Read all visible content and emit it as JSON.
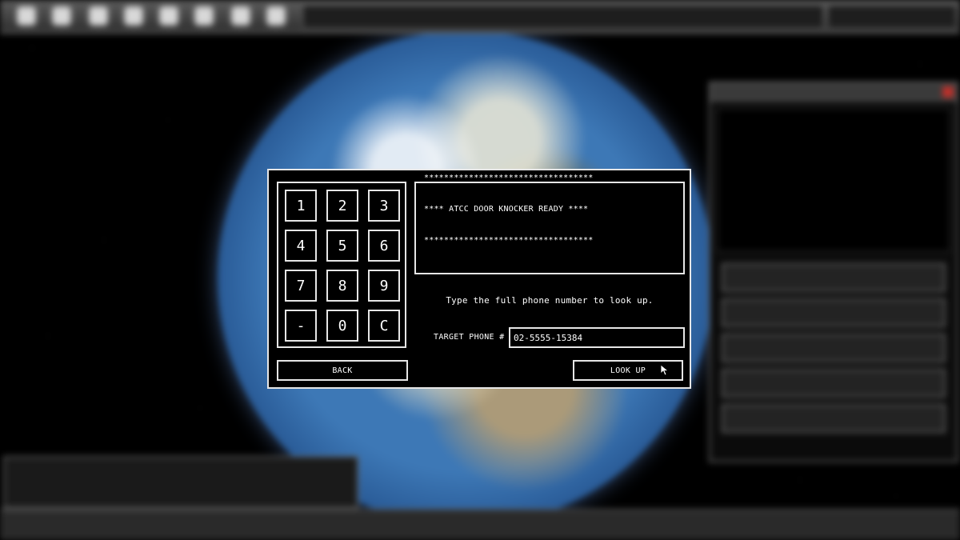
{
  "dialog": {
    "keypad": {
      "keys": [
        "1",
        "2",
        "3",
        "4",
        "5",
        "6",
        "7",
        "8",
        "9",
        "-",
        "0",
        "C"
      ]
    },
    "console": {
      "lines": [
        "**********************************",
        "**** ATCC DOOR KNOCKER READY ****",
        "**********************************"
      ]
    },
    "instruction": "Type the full phone number to look up.",
    "phone_label": "TARGET PHONE #",
    "phone_value": "02-5555-15384",
    "back_label": "BACK",
    "lookup_label": "LOOK UP"
  },
  "icons": {
    "toolbar": [
      "app-icon",
      "app-icon",
      "app-icon",
      "app-icon",
      "app-icon",
      "app-icon",
      "lock-icon",
      "file-icon"
    ],
    "cursor": "mouse-pointer-icon"
  },
  "colors": {
    "dialog_bg": "#000000",
    "dialog_border": "#e6e6e6",
    "close_button": "#c0302a"
  }
}
